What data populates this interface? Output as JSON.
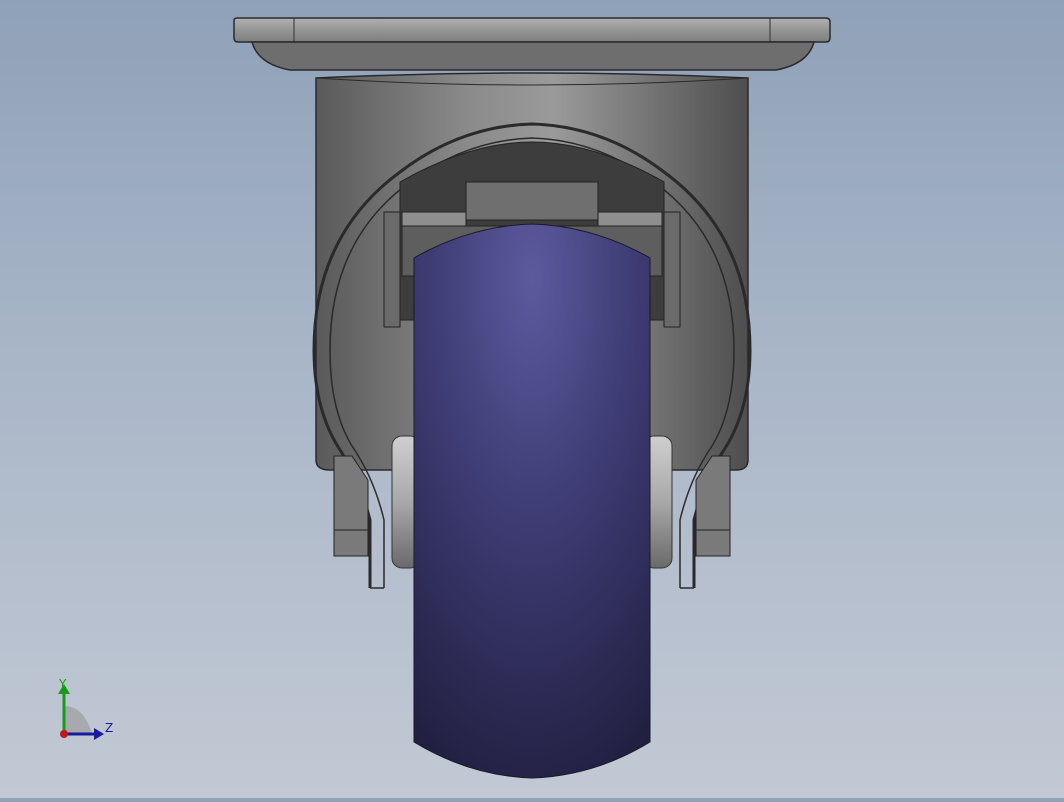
{
  "viewport": {
    "model": "caster-wheel-assembly",
    "view": "front"
  },
  "triad": {
    "y_label": "Y",
    "z_label": "Z",
    "colors": {
      "y": "#1a9a1a",
      "z": "#1a1aa0",
      "x": "#c01818"
    }
  },
  "colors": {
    "background_top": "#8fa1b8",
    "background_bottom": "#c2c9d4",
    "wheel": "#3a3870",
    "metal": "#7a7a7a"
  }
}
